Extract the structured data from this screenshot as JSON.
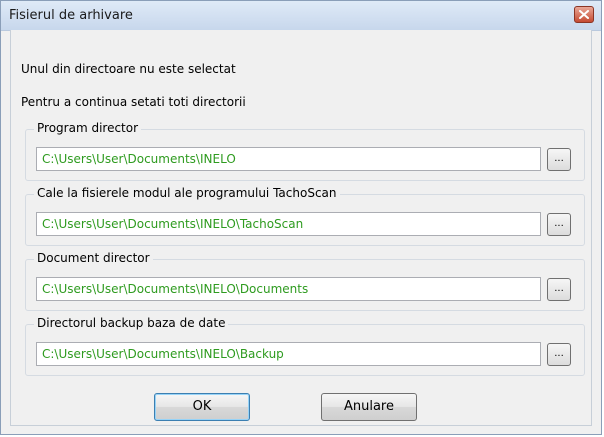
{
  "window": {
    "title": "Fisierul de arhivare"
  },
  "messages": {
    "line1": "Unul din directoare nu este selectat",
    "line2": "Pentru a continua setati toti directorii"
  },
  "groups": [
    {
      "label": "Program director",
      "value": "C:\\Users\\User\\Documents\\INELO",
      "browse_label": "..."
    },
    {
      "label": "Cale la fisierele modul ale programului TachoScan",
      "value": "C:\\Users\\User\\Documents\\INELO\\TachoScan",
      "browse_label": "..."
    },
    {
      "label": "Document director",
      "value": "C:\\Users\\User\\Documents\\INELO\\Documents",
      "browse_label": "..."
    },
    {
      "label": "Directorul backup baza de date",
      "value": "C:\\Users\\User\\Documents\\INELO\\Backup",
      "browse_label": "..."
    }
  ],
  "buttons": {
    "ok": "OK",
    "cancel": "Anulare"
  },
  "colors": {
    "path_text": "#2e9b1f",
    "close_button": "#c54a32"
  },
  "icons": {
    "close": "close-x-icon"
  }
}
